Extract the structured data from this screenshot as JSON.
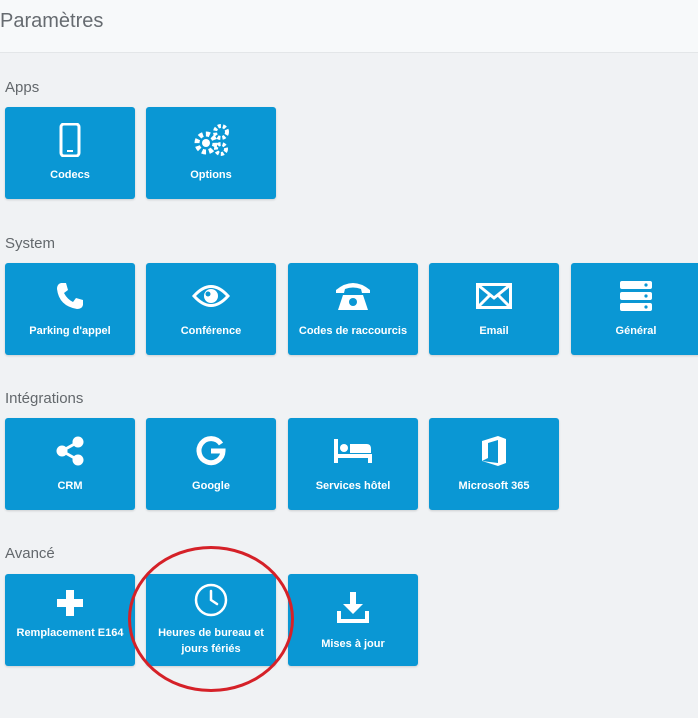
{
  "header": {
    "title": "Paramètres"
  },
  "sections": [
    {
      "title": "Apps",
      "tiles": [
        {
          "label": "Codecs",
          "icon": "phone-mobile-icon"
        },
        {
          "label": "Options",
          "icon": "gears-icon"
        }
      ]
    },
    {
      "title": "System",
      "tiles": [
        {
          "label": "Parking d'appel",
          "icon": "phone-handset-icon"
        },
        {
          "label": "Conférence",
          "icon": "eye-icon"
        },
        {
          "label": "Codes de raccourcis",
          "icon": "desk-phone-icon"
        },
        {
          "label": "Email",
          "icon": "envelope-icon"
        },
        {
          "label": "Général",
          "icon": "server-icon"
        }
      ]
    },
    {
      "title": "Intégrations",
      "tiles": [
        {
          "label": "CRM",
          "icon": "share-icon"
        },
        {
          "label": "Google",
          "icon": "google-icon"
        },
        {
          "label": "Services hôtel",
          "icon": "bed-icon"
        },
        {
          "label": "Microsoft 365",
          "icon": "office-icon"
        }
      ]
    },
    {
      "title": "Avancé",
      "tiles": [
        {
          "label": "Remplacement E164",
          "icon": "plus-icon"
        },
        {
          "label": "Heures de bureau et jours fériés",
          "icon": "clock-icon"
        },
        {
          "label": "Mises à jour",
          "icon": "download-icon"
        }
      ]
    }
  ],
  "colors": {
    "tile": "#0a97d4",
    "background": "#f0f2f4",
    "annotation": "#d52128"
  }
}
